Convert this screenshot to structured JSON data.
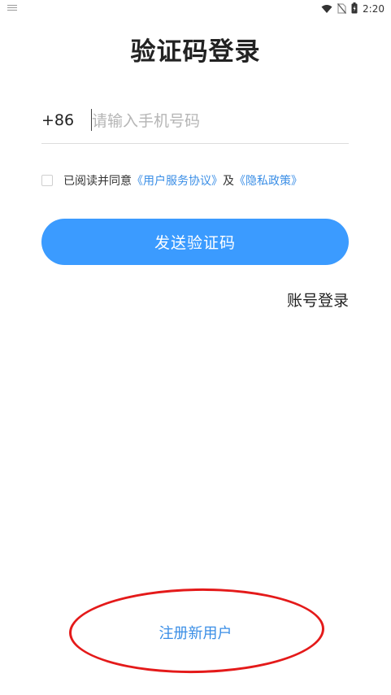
{
  "status_bar": {
    "time": "2:20",
    "icons": [
      "notification-icon",
      "wifi-icon",
      "no-sim-icon",
      "battery-charging-icon"
    ]
  },
  "page": {
    "title": "验证码登录"
  },
  "phone": {
    "country_code": "+86",
    "placeholder": "请输入手机号码",
    "value": ""
  },
  "agreement": {
    "checked": false,
    "prefix": "已阅读并同意",
    "terms_link": "《用户服务协议》",
    "connector": "及",
    "privacy_link": "《隐私政策》"
  },
  "actions": {
    "send_code": "发送验证码",
    "account_login": "账号登录",
    "register": "注册新用户"
  },
  "colors": {
    "primary_button": "#3b9bff",
    "link": "#3a8ee6",
    "annotation": "#e41a1a"
  }
}
